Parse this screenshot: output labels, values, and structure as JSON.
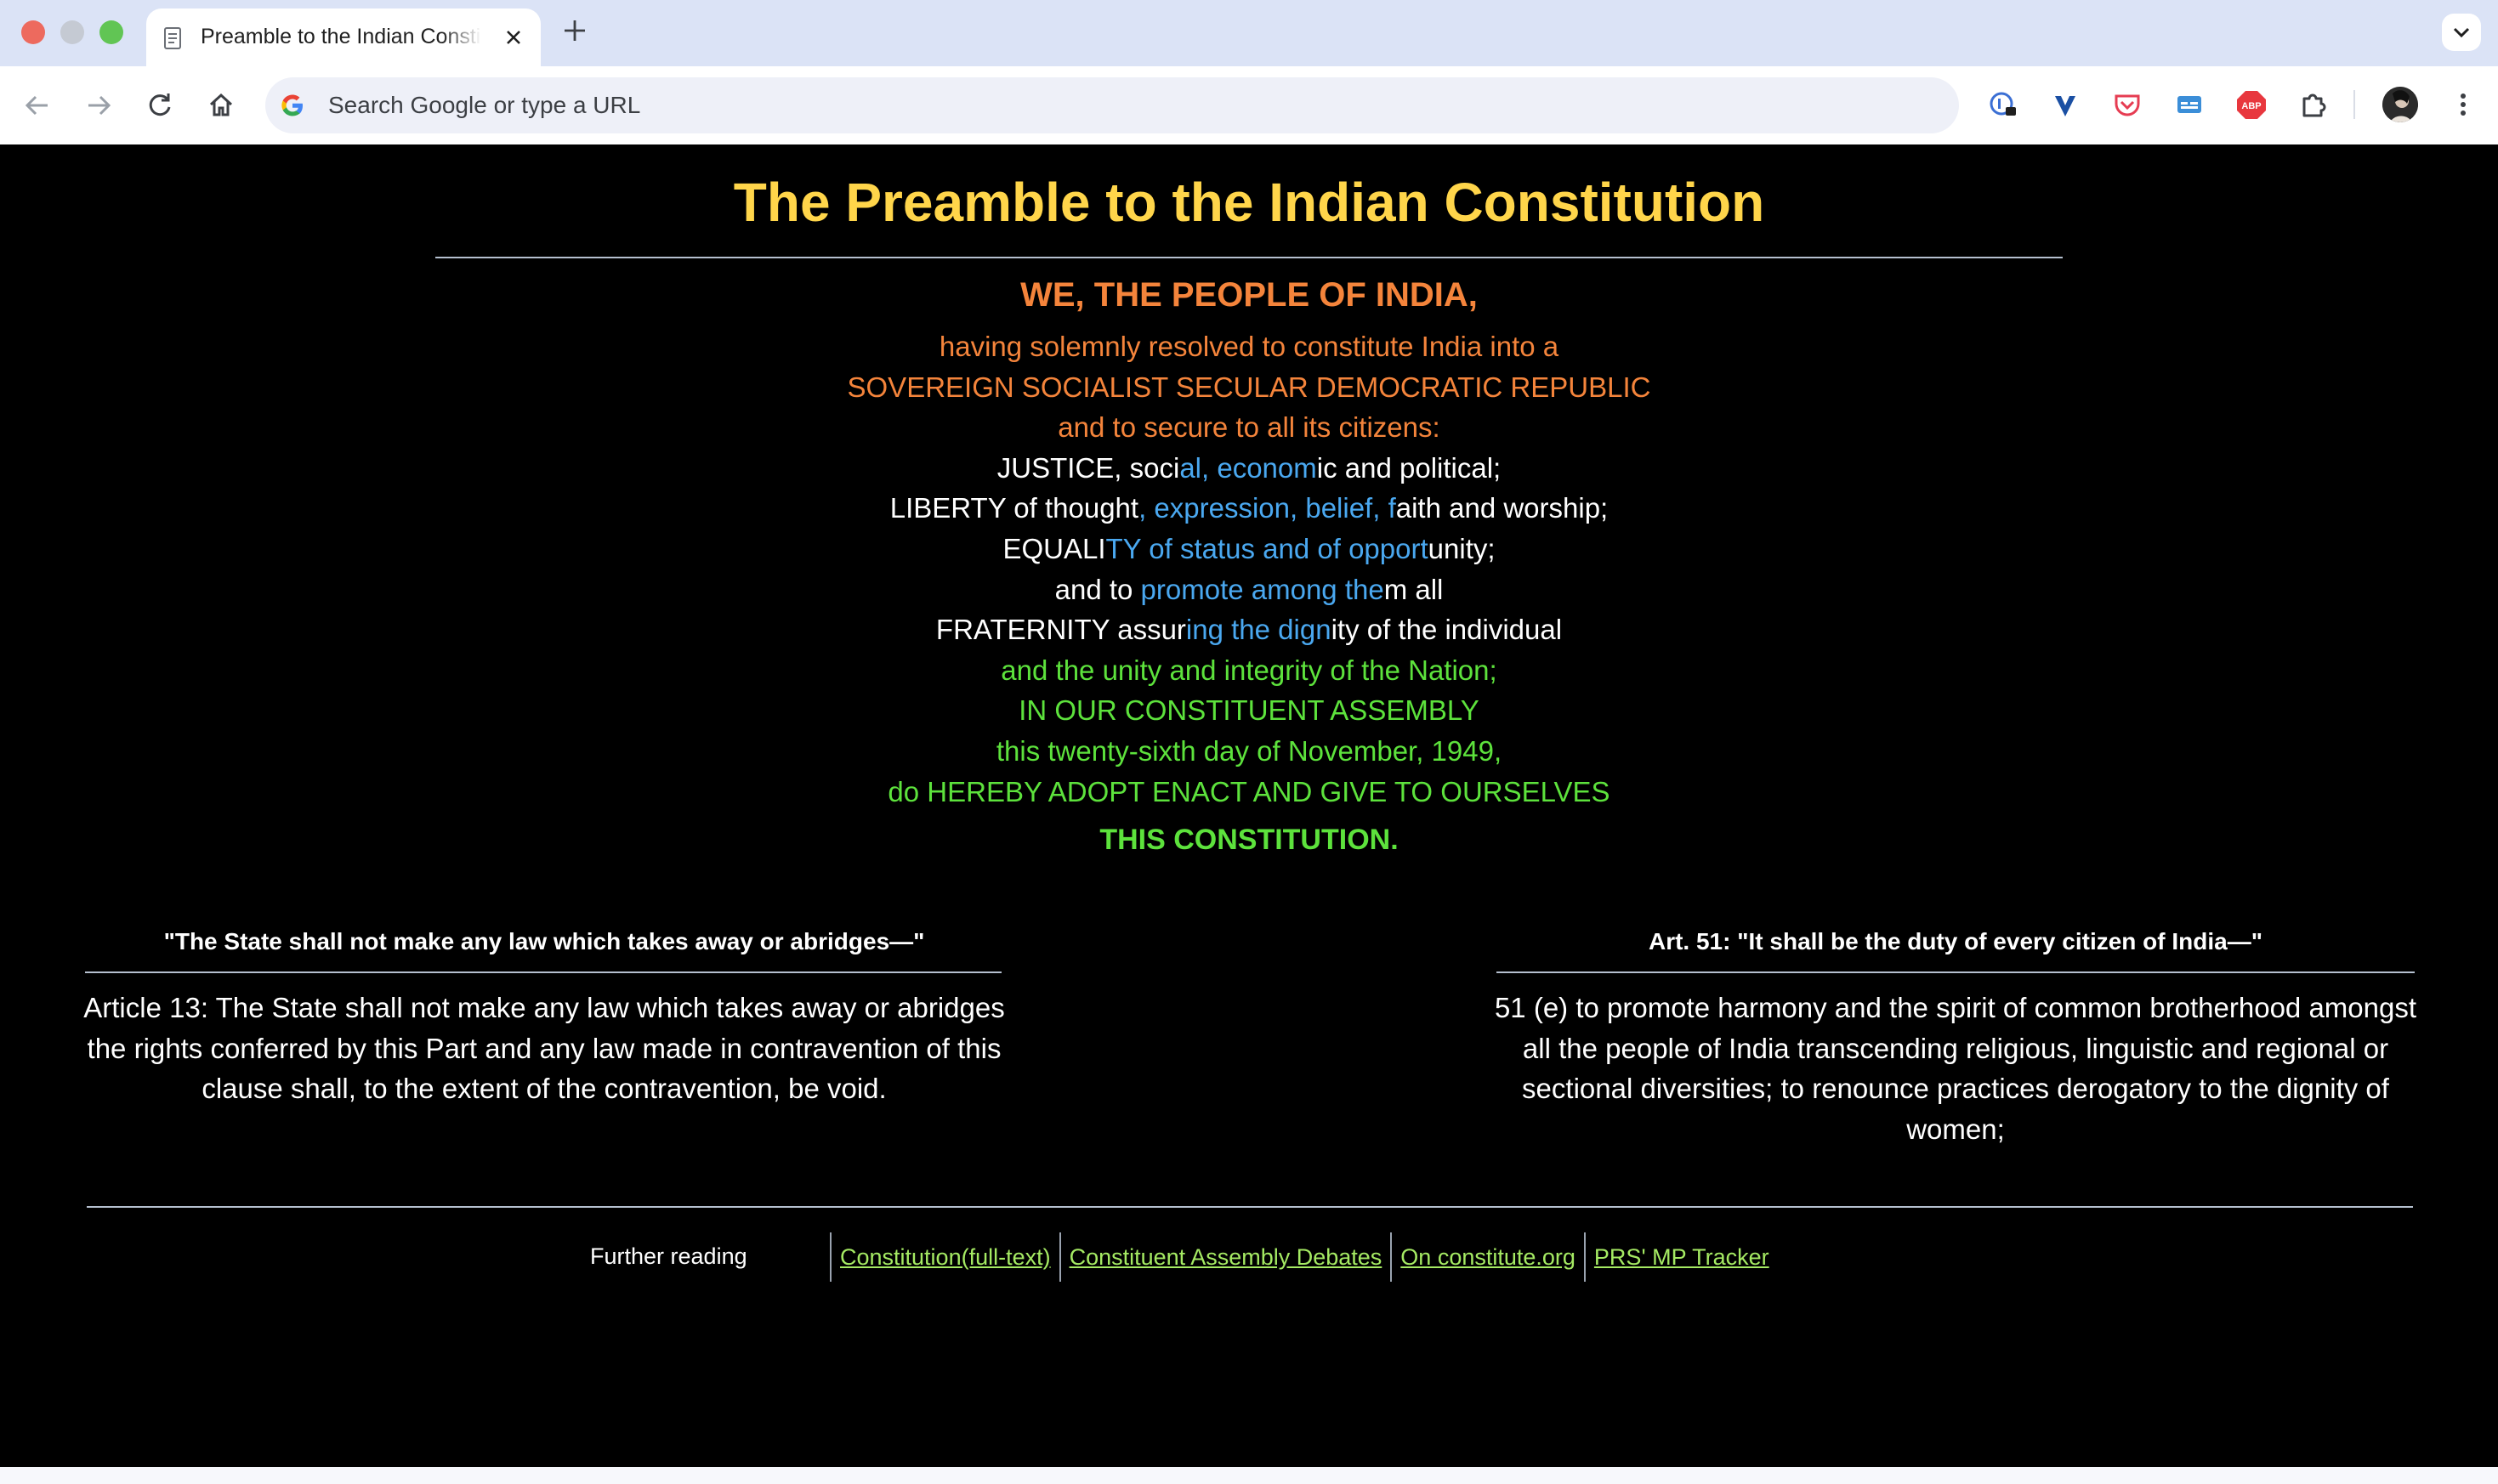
{
  "browser": {
    "tab_title": "Preamble to the Indian Constitution",
    "omnibox_placeholder": "Search Google or type a URL"
  },
  "page": {
    "title": "The Preamble to the Indian Constitution",
    "preamble": {
      "lead": "WE, THE PEOPLE OF INDIA,",
      "lines": [
        [
          {
            "t": "having solemnly resolved to constitute India into a",
            "c": "orange"
          }
        ],
        [
          {
            "t": "SOVEREIGN SOCIALIST SECULAR DEMOCRATIC REPUBLIC",
            "c": "orange"
          }
        ],
        [
          {
            "t": "and to secure to all its citizens:",
            "c": "orange"
          }
        ],
        [
          {
            "t": "JUSTICE, soci",
            "c": "white"
          },
          {
            "t": "al, econom",
            "c": "blue"
          },
          {
            "t": "ic and political;",
            "c": "white"
          }
        ],
        [
          {
            "t": "LIBERTY of thought",
            "c": "white"
          },
          {
            "t": ", expression, belief, f",
            "c": "blue"
          },
          {
            "t": "aith and worship;",
            "c": "white"
          }
        ],
        [
          {
            "t": "EQUALI",
            "c": "white"
          },
          {
            "t": "TY of status and of opport",
            "c": "blue"
          },
          {
            "t": "unity;",
            "c": "white"
          }
        ],
        [
          {
            "t": "and to ",
            "c": "white"
          },
          {
            "t": "promote among the",
            "c": "blue"
          },
          {
            "t": "m all",
            "c": "white"
          }
        ],
        [
          {
            "t": "FRATERNITY assur",
            "c": "white"
          },
          {
            "t": "ing the dign",
            "c": "blue"
          },
          {
            "t": "ity of the individual",
            "c": "white"
          }
        ],
        [
          {
            "t": "and the unity and integrity of the Nation;",
            "c": "green"
          }
        ],
        [
          {
            "t": "IN OUR CONSTITUENT ASSEMBLY",
            "c": "green"
          }
        ],
        [
          {
            "t": "this twenty-sixth day of November, 1949,",
            "c": "green"
          }
        ],
        [
          {
            "t": "do HEREBY ADOPT ENACT AND GIVE TO OURSELVES",
            "c": "green"
          }
        ]
      ],
      "closing": "THIS CONSTITUTION."
    },
    "left_panel": {
      "heading": "\"The State shall not make any law which takes away or abridges—\"",
      "body_lines": [
        "Article 13: The State shall not make any law which takes away or abridges",
        "the rights conferred by this Part and any law made in contravention of this",
        "clause shall, to the extent of the contravention, be void."
      ]
    },
    "right_panel": {
      "heading": "Art. 51: \"It shall be the duty of every citizen of India—\"",
      "body_lines": [
        "51 (e) to promote harmony and the spirit of common brotherhood amongst",
        "all the people of India transcending religious, linguistic and regional or",
        "sectional diversities; to renounce practices derogatory to the dignity of",
        "women;"
      ]
    },
    "footer": {
      "label": "Further reading",
      "links": [
        "Constitution(full-text)",
        "Constituent Assembly Debates",
        "On constitute.org",
        "PRS' MP Tracker"
      ]
    }
  },
  "colors": {
    "title": "#ffd54a",
    "orange": "#f4843b",
    "white": "#ffffff",
    "blue": "#4aa8f0",
    "green": "#5de23c",
    "link": "#a5ea63",
    "background": "#000000"
  }
}
